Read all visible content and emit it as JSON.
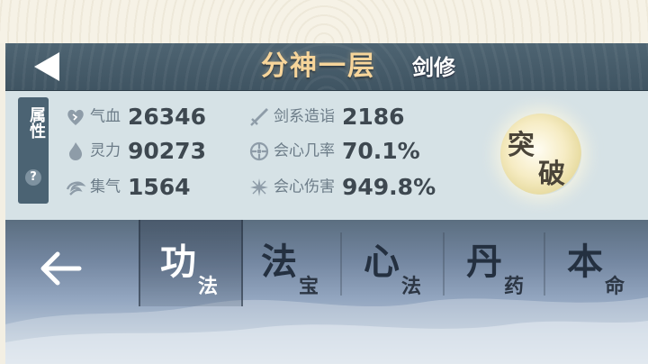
{
  "header": {
    "title": "分神一层",
    "subtitle": "剑修"
  },
  "attributes": {
    "label": "属性",
    "help": "?"
  },
  "stats_left": [
    {
      "icon": "heart-icon",
      "label": "气血",
      "value": "26346"
    },
    {
      "icon": "flame-icon",
      "label": "灵力",
      "value": "90273"
    },
    {
      "icon": "swirl-icon",
      "label": "集气",
      "value": "1564"
    }
  ],
  "stats_right": [
    {
      "icon": "sword-icon",
      "label": "剑系造诣",
      "value": "2186"
    },
    {
      "icon": "crit-rate-icon",
      "label": "会心几率",
      "value": "70.1%"
    },
    {
      "icon": "crit-damage-icon",
      "label": "会心伤害",
      "value": "949.8%"
    }
  ],
  "breakthrough": {
    "char1": "突",
    "char2": "破"
  },
  "tabs": [
    {
      "big": "功",
      "small": "法",
      "active": true
    },
    {
      "big": "法",
      "small": "宝",
      "active": false
    },
    {
      "big": "心",
      "small": "法",
      "active": false
    },
    {
      "big": "丹",
      "small": "药",
      "active": false
    },
    {
      "big": "本",
      "small": "命",
      "active": false
    }
  ],
  "colors": {
    "title_gold": "#f7d59a",
    "header_bg": "#44596a",
    "panel_bg": "#d6e2e6",
    "value_text": "#3e4850"
  }
}
